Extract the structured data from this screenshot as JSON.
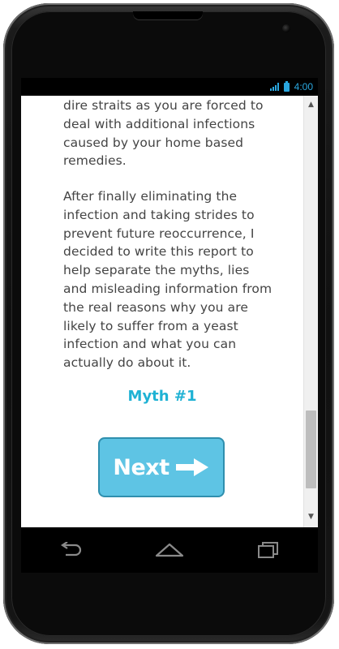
{
  "status_bar": {
    "time": "4:00",
    "accent_color": "#2aa7df",
    "icons": [
      "signal-icon",
      "battery-icon"
    ]
  },
  "article": {
    "paragraph_1": "dire straits as you are forced to deal with additional infections caused by your home based remedies.",
    "paragraph_2": "After finally eliminating the infection and taking strides to prevent future reoccurrence, I decided to write this report to help separate the myths, lies and misleading information from the real reasons why you are likely to suffer from a yeast infection and what you can actually do about it.",
    "section_heading": "Myth #1",
    "heading_color": "#1fb2d4"
  },
  "next_button": {
    "label": "Next",
    "icon": "arrow-right-icon",
    "color": "#5ec4e4"
  },
  "scrollbar": {
    "up_icon": "scroll-up-arrow-icon",
    "down_icon": "scroll-down-arrow-icon"
  },
  "nav_bar": {
    "buttons": [
      "back-icon",
      "home-icon",
      "recent-apps-icon"
    ]
  }
}
